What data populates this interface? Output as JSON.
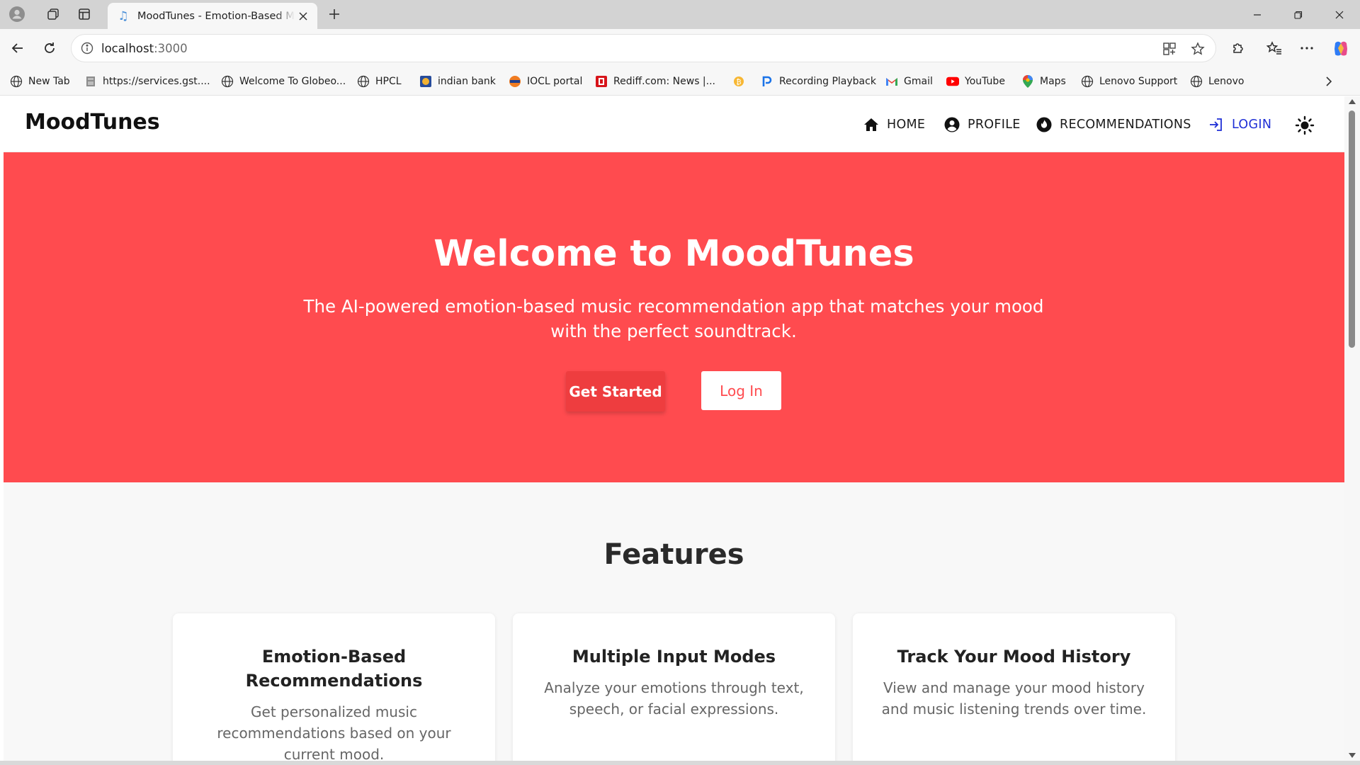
{
  "browser": {
    "tab_title": "MoodTunes - Emotion-Based Music Recommendations",
    "url_host": "localhost",
    "url_port": ":3000",
    "bookmarks": [
      {
        "label": "New Tab",
        "icon": "globe-icon"
      },
      {
        "label": "https://services.gst....",
        "icon": "emblem-icon"
      },
      {
        "label": "Welcome To Globeo...",
        "icon": "globe-icon"
      },
      {
        "label": "HPCL",
        "icon": "globe-icon"
      },
      {
        "label": "indian bank",
        "icon": "bank-icon"
      },
      {
        "label": "IOCL portal",
        "icon": "iocl-icon"
      },
      {
        "label": "Rediff.com: News |...",
        "icon": "rediff-icon"
      },
      {
        "label": "",
        "icon": "coin-icon"
      },
      {
        "label": "Recording Playback",
        "icon": "play-p-icon"
      },
      {
        "label": "Gmail",
        "icon": "gmail-icon"
      },
      {
        "label": "YouTube",
        "icon": "youtube-icon"
      },
      {
        "label": "Maps",
        "icon": "maps-pin-icon"
      },
      {
        "label": "Lenovo Support",
        "icon": "globe-icon"
      },
      {
        "label": "Lenovo",
        "icon": "globe-icon"
      }
    ]
  },
  "app": {
    "logo": "MoodTunes",
    "nav": {
      "home": "HOME",
      "profile": "PROFILE",
      "recommendations": "RECOMMENDATIONS",
      "login": "LOGIN"
    },
    "hero": {
      "title": "Welcome to MoodTunes",
      "subtitle": "The AI-powered emotion-based music recommendation app that matches your mood with the perfect soundtrack.",
      "primary_button": "Get Started",
      "secondary_button": "Log In"
    },
    "features": {
      "title": "Features",
      "cards": [
        {
          "title": "Emotion-Based Recommendations",
          "text": "Get personalized music recommendations based on your current mood."
        },
        {
          "title": "Multiple Input Modes",
          "text": "Analyze your emotions through text, speech, or facial expressions."
        },
        {
          "title": "Track Your Mood History",
          "text": "View and manage your mood history and music listening trends over time."
        }
      ]
    }
  },
  "colors": {
    "hero_bg": "#ff4b4f",
    "primary_button": "#ee3d3f",
    "login_link": "#1f2fd6"
  }
}
